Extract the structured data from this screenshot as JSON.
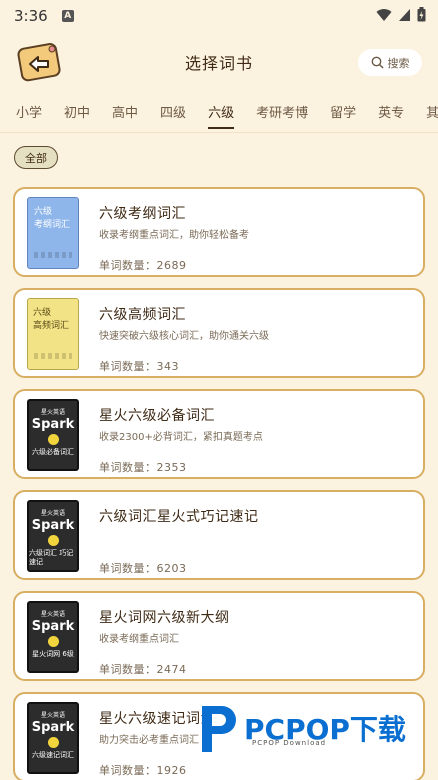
{
  "status_bar": {
    "time": "3:36",
    "notification_letter": "A"
  },
  "header": {
    "title": "选择词书",
    "search_label": "搜索",
    "back_icon": "back-arrow-icon"
  },
  "tabs": [
    {
      "label": "小学"
    },
    {
      "label": "初中"
    },
    {
      "label": "高中"
    },
    {
      "label": "四级"
    },
    {
      "label": "六级",
      "active": true
    },
    {
      "label": "考研考博"
    },
    {
      "label": "留学"
    },
    {
      "label": "英专"
    },
    {
      "label": "其他"
    }
  ],
  "filter": {
    "label": "全部"
  },
  "count_prefix": "单词数量：",
  "books": [
    {
      "title": "六级考纲词汇",
      "desc": "收录考纲重点词汇，助你轻松备考",
      "count": "2689",
      "cover": {
        "style": "blue",
        "lines": [
          "六级",
          "考纲词汇"
        ]
      }
    },
    {
      "title": "六级高频词汇",
      "desc": "快速突破六级核心词汇，助你通关六级",
      "count": "343",
      "cover": {
        "style": "yellow",
        "lines": [
          "六级",
          "高频词汇"
        ]
      }
    },
    {
      "title": "星火六级必备词汇",
      "desc": "收录2300+必背词汇，紧扣真题考点",
      "count": "2353",
      "cover": {
        "style": "dark",
        "top": "星火英语",
        "brand": "Spark",
        "sub": "六级必备词汇"
      }
    },
    {
      "title": "六级词汇星火式巧记速记",
      "desc": "",
      "count": "6203",
      "cover": {
        "style": "dark",
        "top": "星火英语",
        "brand": "Spark",
        "sub": "六级词汇 巧记速记"
      }
    },
    {
      "title": "星火词网六级新大纲",
      "desc": "收录考纲重点词汇",
      "count": "2474",
      "cover": {
        "style": "dark",
        "top": "星火英语",
        "brand": "Spark",
        "sub": "星火词网 6级"
      }
    },
    {
      "title": "星火六级速记词汇",
      "desc": "助力突击必考重点词汇",
      "count": "1926",
      "cover": {
        "style": "dark",
        "top": "星火英语",
        "brand": "Spark",
        "sub": "六级速记词汇"
      }
    }
  ],
  "watermark": {
    "text": "PCPOP下载",
    "sub": "PCPOP Download"
  },
  "colors": {
    "background": "#fbf2df",
    "card_border": "#d8ae62",
    "text_dark": "#3f2a15",
    "watermark_blue": "#0a6fd0"
  }
}
